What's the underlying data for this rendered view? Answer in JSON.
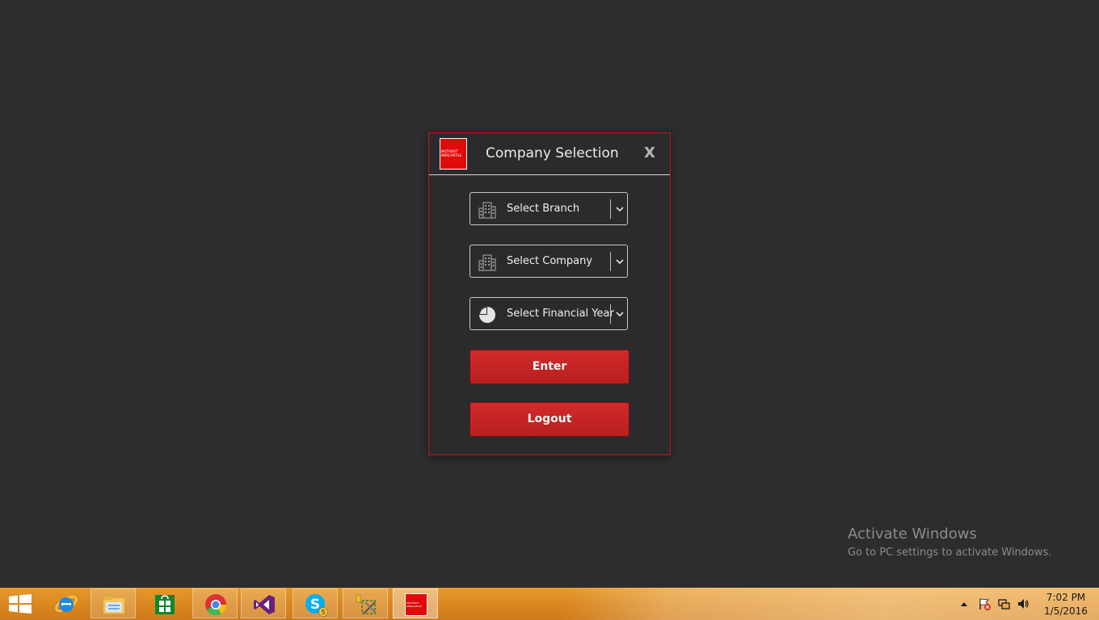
{
  "dialog": {
    "title": "Company Selection",
    "close_label": "X",
    "logo_text": "MUTHOOT MERCANTILE",
    "branch": {
      "label": "Select Branch",
      "icon": "building-icon"
    },
    "company": {
      "label": "Select Company",
      "icon": "building-icon"
    },
    "financial_year": {
      "label": "Select Financial Year",
      "icon": "pie-chart-icon"
    },
    "enter_label": "Enter",
    "logout_label": "Logout"
  },
  "watermark": {
    "title": "Activate Windows",
    "subtitle": "Go to PC settings to activate Windows."
  },
  "taskbar": {
    "apps": [
      {
        "name": "Internet Explorer",
        "icon": "internet-explorer-icon"
      },
      {
        "name": "File Explorer",
        "icon": "file-explorer-icon"
      },
      {
        "name": "Store",
        "icon": "store-icon"
      },
      {
        "name": "Google Chrome",
        "icon": "chrome-icon"
      },
      {
        "name": "Visual Studio",
        "icon": "visual-studio-icon"
      },
      {
        "name": "Skype",
        "icon": "skype-icon",
        "badge": "5"
      },
      {
        "name": "Tools",
        "icon": "tools-icon"
      },
      {
        "name": "Muthoot Mercantile",
        "icon": "muthoot-logo-icon",
        "logo_text": "MUTHOOT MERCANTILE"
      }
    ],
    "clock": {
      "time": "7:02 PM",
      "date": "1/5/2016"
    }
  },
  "colors": {
    "accent_red": "#c4161c",
    "background": "#2d2d2f",
    "taskbar": "#d9861f"
  }
}
